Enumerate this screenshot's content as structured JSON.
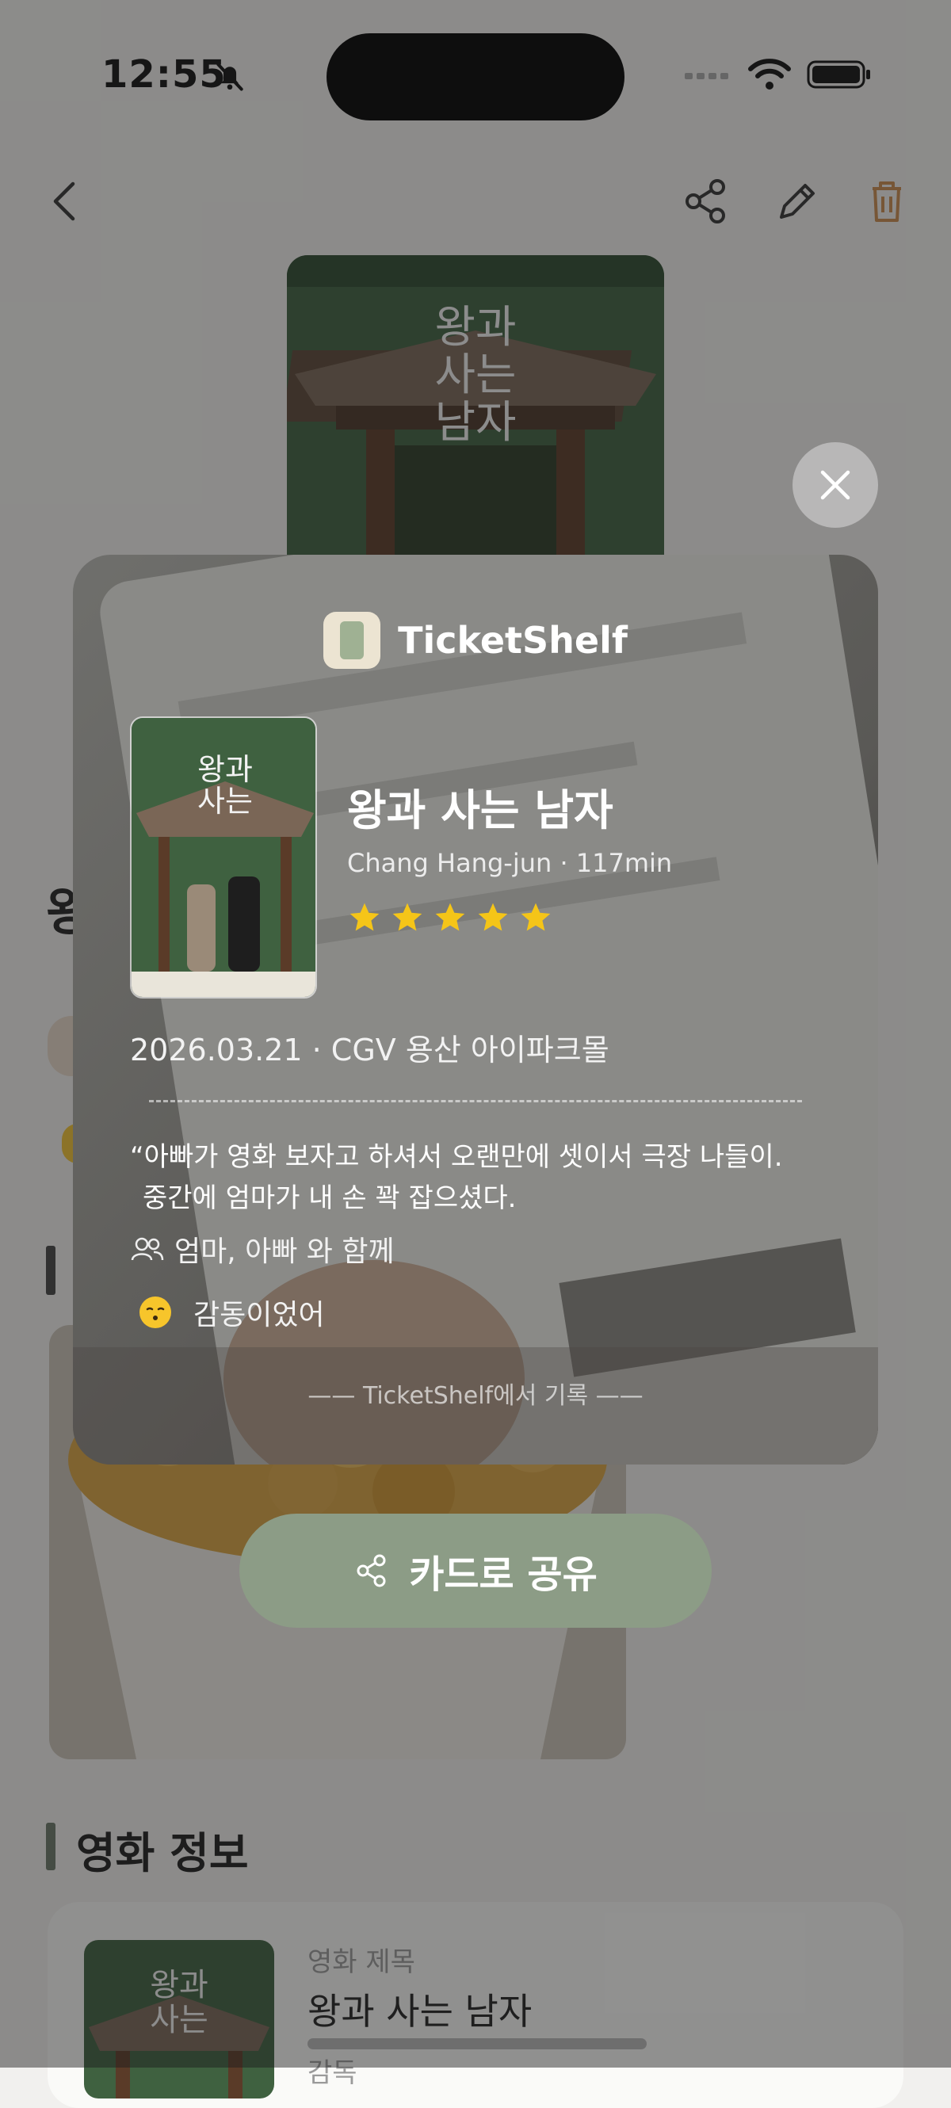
{
  "status_bar": {
    "time": "12:55"
  },
  "background": {
    "title_fragment": "왕",
    "section_title": "영화 정보",
    "info_card": {
      "title_label": "영화 제목",
      "title_value": "왕과 사는 남자",
      "director_label": "감독"
    }
  },
  "card": {
    "brand": "TicketShelf",
    "movie_title": "왕과 사는 남자",
    "meta": "Chang Hang-jun · 117min",
    "rating": 5,
    "date_venue": "2026.03.21 · CGV 용산 아이파크몰",
    "quote_line1": "“아빠가 영화 보자고 하셔서 오랜만에 셋이서 극장 나들이.",
    "quote_line2": "중간에 엄마가 내 손 꽉 잡으셨다.",
    "companion": "엄마, 아빠 와 함께",
    "emotion": "감동이었어",
    "footer": "—— TicketShelf에서 기록 ——"
  },
  "share_button": {
    "label": "카드로 공유"
  },
  "icons": {
    "back": "chevron-left-icon",
    "share": "share-icon",
    "edit": "pencil-icon",
    "delete": "trash-icon",
    "close": "close-icon",
    "companion": "people-icon",
    "emotion": "moved-emoji-icon"
  },
  "colors": {
    "accent": "#8c9c86",
    "delete": "#c98a4e",
    "star": "#f5c518"
  }
}
